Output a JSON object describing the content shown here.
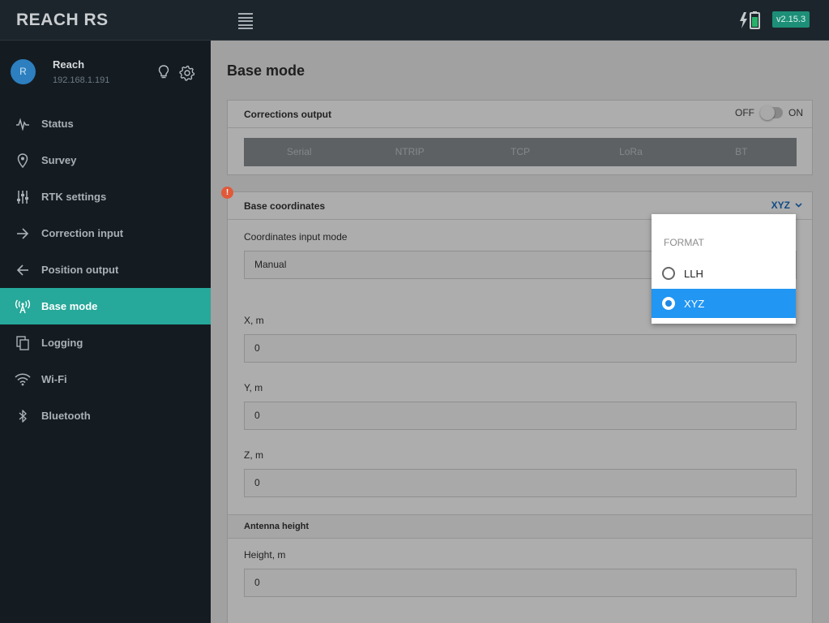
{
  "app": {
    "logo": "REACH RS",
    "version": "v2.15.3"
  },
  "user": {
    "initial": "R",
    "name": "Reach",
    "ip": "192.168.1.191"
  },
  "sidebar": {
    "items": [
      {
        "label": "Status",
        "icon": "pulse-icon"
      },
      {
        "label": "Survey",
        "icon": "location-pin-icon"
      },
      {
        "label": "RTK settings",
        "icon": "sliders-icon"
      },
      {
        "label": "Correction input",
        "icon": "arrow-right-icon"
      },
      {
        "label": "Position output",
        "icon": "arrow-left-icon"
      },
      {
        "label": "Base mode",
        "icon": "antenna-icon",
        "active": true
      },
      {
        "label": "Logging",
        "icon": "files-icon"
      },
      {
        "label": "Wi-Fi",
        "icon": "wifi-icon"
      },
      {
        "label": "Bluetooth",
        "icon": "bluetooth-icon"
      }
    ]
  },
  "main": {
    "title": "Base mode",
    "corrections": {
      "title": "Corrections output",
      "off_label": "OFF",
      "on_label": "ON",
      "state": "off",
      "options": [
        "Serial",
        "NTRIP",
        "TCP",
        "LoRa",
        "BT"
      ]
    },
    "base_coordinates": {
      "warning": "!",
      "title": "Base coordinates",
      "format_value": "XYZ",
      "input_mode_label": "Coordinates input mode",
      "input_mode_value": "Manual",
      "x_label": "X, m",
      "x_value": "0",
      "y_label": "Y, m",
      "y_value": "0",
      "z_label": "Z, m",
      "z_value": "0"
    },
    "antenna": {
      "title": "Antenna height",
      "height_label": "Height, m",
      "height_value": "0"
    }
  },
  "dropdown": {
    "header": "FORMAT",
    "options": [
      {
        "label": "LLH",
        "selected": false
      },
      {
        "label": "XYZ",
        "selected": true
      }
    ]
  },
  "colors": {
    "accent": "#26a89a",
    "selected": "#2196f3",
    "link": "#1a6fc4",
    "warning": "#e05a3a",
    "battery": "#1d8f78"
  }
}
